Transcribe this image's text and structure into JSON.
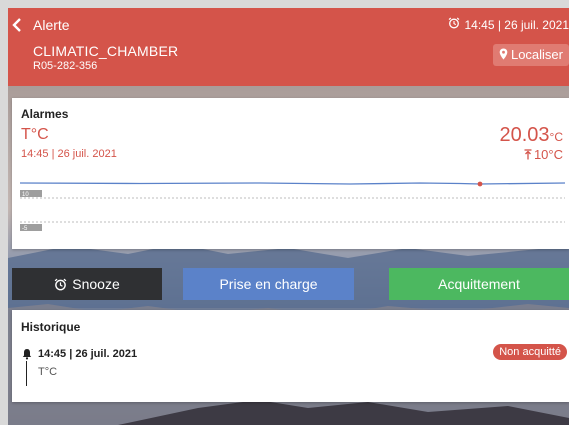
{
  "colors": {
    "header": "#d4544a",
    "accent_red": "#d4544a",
    "snooze_bg": "#2f3033",
    "prise_bg": "#5b82c9",
    "ack_bg": "#4cb860",
    "chart_line": "#5b82c9"
  },
  "header": {
    "back_icon": "chevron-left-icon",
    "title": "Alerte",
    "time_icon": "alarm-clock-icon",
    "datetime": "14:45 | 26 juil. 2021",
    "device_name": "CLIMATIC_CHAMBER",
    "serial": "R05-282-356",
    "localiser_icon": "location-pin-icon",
    "localiser_label": "Localiser"
  },
  "alarm": {
    "title": "Alarmes",
    "variable": "T°C",
    "datetime": "14:45 | 26 juil. 2021",
    "value": "20.03",
    "value_unit": "°C",
    "threshold_icon": "threshold-up-icon",
    "threshold": "10°C",
    "chart": {
      "tick_labels": [
        "10",
        "-5"
      ]
    }
  },
  "actions": {
    "snooze_icon": "alarm-clock-icon",
    "snooze_label": "Snooze",
    "prise_label": "Prise en charge",
    "ack_label": "Acquittement"
  },
  "history": {
    "title": "Historique",
    "items": [
      {
        "icon": "bell-icon",
        "datetime": "14:45 | 26 juil. 2021",
        "variable": "T°C",
        "status": "Non acquitté"
      }
    ]
  }
}
